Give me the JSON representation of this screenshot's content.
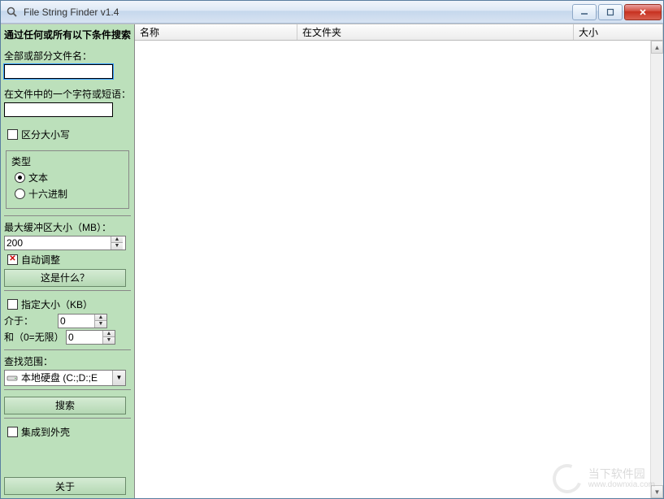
{
  "window": {
    "title": "File String Finder v1.4"
  },
  "sidebar": {
    "title": "通过任何或所有以下条件搜索",
    "filename_label": "全部或部分文件名：",
    "filename_value": "",
    "phrase_label": "在文件中的一个字符或短语：",
    "phrase_value": "",
    "case_label": "区分大小写",
    "case_checked": false,
    "type_legend": "类型",
    "type_text": "文本",
    "type_hex": "十六进制",
    "type_selected": "text",
    "buffer_label": "最大缓冲区大小（MB）：",
    "buffer_value": "200",
    "autoadjust_label": "自动调整",
    "autoadjust_checked": false,
    "whatis_label": "这是什么？",
    "size_enable_label": "指定大小（KB）",
    "size_enable_checked": false,
    "between_label": "介于：",
    "between_value": "0",
    "and_label": "和（0=无限）",
    "and_value": "0",
    "scope_label": "查找范围：",
    "scope_value": "本地硬盘 (C:;D:;E",
    "search_label": "搜索",
    "shell_label": "集成到外壳",
    "shell_checked": false,
    "about_label": "关于"
  },
  "columns": {
    "name": "名称",
    "folder": "在文件夹",
    "size": "大小"
  },
  "watermark": {
    "text": "当下软件园",
    "url": "www.downxia.com"
  }
}
